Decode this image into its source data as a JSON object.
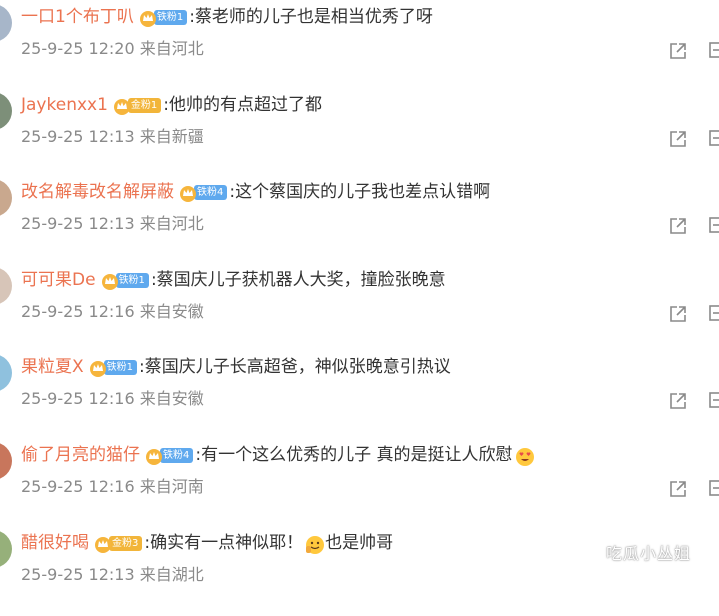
{
  "comments": [
    {
      "username": "一口1个布丁叭",
      "badge": "铁粉1",
      "badge_style": "blue",
      "text": "蔡老师的儿子也是相当优秀了呀",
      "time": "25-9-25 12:20",
      "location": "来自河北",
      "avatar_color": "#a7b6c9",
      "emoji": []
    },
    {
      "username": "Jaykenxx1",
      "badge": "金粉1",
      "badge_style": "gold",
      "text": "他帅的有点超过了都",
      "time": "25-9-25 12:13",
      "location": "来自新疆",
      "avatar_color": "#7d8f79",
      "emoji": []
    },
    {
      "username": "改名解毒改名解屏蔽",
      "badge": "铁粉4",
      "badge_style": "blue",
      "text": "这个蔡国庆的儿子我也差点认错啊",
      "time": "25-9-25 12:13",
      "location": "来自河北",
      "avatar_color": "#c9a88e",
      "emoji": []
    },
    {
      "username": "可可果De",
      "badge": "铁粉1",
      "badge_style": "blue",
      "text": "蔡国庆儿子获机器人大奖，撞脸张晚意",
      "time": "25-9-25 12:16",
      "location": "来自安徽",
      "avatar_color": "#d7c5b8",
      "emoji": []
    },
    {
      "username": "果粒夏X",
      "badge": "铁粉1",
      "badge_style": "blue",
      "text": "蔡国庆儿子长高超爸，神似张晚意引热议",
      "time": "25-9-25 12:16",
      "location": "来自安徽",
      "avatar_color": "#8fc1de",
      "emoji": []
    },
    {
      "username": "偷了月亮的猫仔",
      "badge": "铁粉4",
      "badge_style": "blue",
      "text": "有一个这么优秀的儿子 真的是挺让人欣慰",
      "time": "25-9-25 12:16",
      "location": "来自河南",
      "avatar_color": "#c8765c",
      "emoji": [
        "heart-eyes-emoji"
      ]
    },
    {
      "username": "醋很好喝",
      "badge": "金粉3",
      "badge_style": "gold",
      "text": "确实有一点神似耶！",
      "text_after": "也是帅哥",
      "time": "25-9-25 12:13",
      "location": "来自湖北",
      "avatar_color": "#96b07a",
      "emoji": [
        "thumb-smile-emoji"
      ]
    }
  ],
  "icons": {
    "share": "share-icon",
    "more": "more-icon"
  },
  "colors": {
    "username": "#eb7350",
    "text": "#333333",
    "meta": "#8a8a8a",
    "badge_blue": "#5fa9ee",
    "badge_gold": "#f2b53a"
  },
  "watermark": "吃瓜小丛姐"
}
